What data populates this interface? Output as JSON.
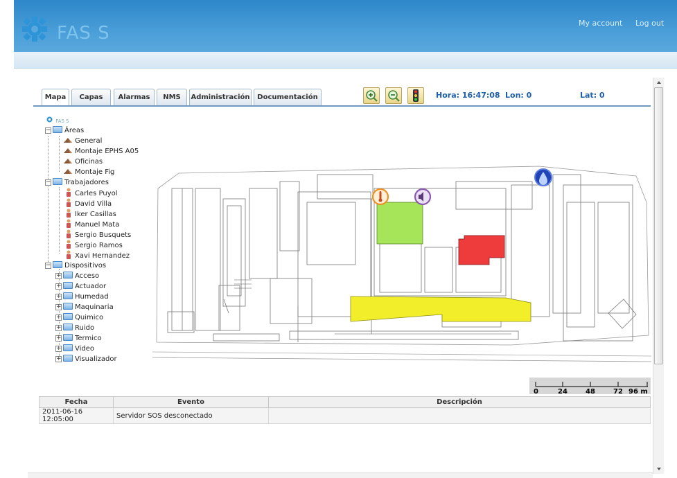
{
  "header": {
    "logo_text": "FAS S",
    "my_account": "My account",
    "log_out": "Log out"
  },
  "tabs": [
    {
      "label": "Mapa",
      "active": true
    },
    {
      "label": "Capas"
    },
    {
      "label": "Alarmas"
    },
    {
      "label": "NMS"
    },
    {
      "label": "Administración"
    },
    {
      "label": "Documentación"
    }
  ],
  "toolbar": {
    "zoom_in": "zoom-in-icon",
    "zoom_out": "zoom-out-icon",
    "traffic_light": "traffic-light-icon"
  },
  "status": {
    "hora": "Hora: 16:47:08",
    "lon": "Lon: 0",
    "lat": "Lat: 0"
  },
  "tree": {
    "root": "FAS S",
    "areas": {
      "label": "Áreas",
      "items": [
        "General",
        "Montaje EPHS A05",
        "Oficinas",
        "Montaje Fig"
      ]
    },
    "trabajadores": {
      "label": "Trabajadores",
      "items": [
        "Carles Puyol",
        "David Villa",
        "Iker Casillas",
        "Manuel Mata",
        "Sergio Busquets",
        "Sergio Ramos",
        "Xavi Hernandez"
      ]
    },
    "dispositivos": {
      "label": "Dispositivos",
      "items": [
        "Acceso",
        "Actuador",
        "Humedad",
        "Maquinaria",
        "Quimico",
        "Ruido",
        "Termico",
        "Video",
        "Visualizador"
      ]
    }
  },
  "map": {
    "zones": [
      {
        "name": "green-zone",
        "color": "#a6e45a"
      },
      {
        "name": "red-zone",
        "color": "#ee3b3b"
      },
      {
        "name": "yellow-zone",
        "color": "#f2ef2a"
      }
    ],
    "markers": [
      "thermometer-marker-icon",
      "noise-marker-icon",
      "humidity-marker-icon"
    ]
  },
  "scale": {
    "ticks": [
      "0",
      "24",
      "48",
      "72",
      "96 m"
    ]
  },
  "events": {
    "columns": [
      "Fecha",
      "Evento",
      "Descripción"
    ],
    "rows": [
      {
        "fecha": "2011-06-16 12:05:00",
        "evento": "Servidor SOS desconectado",
        "descripcion": ""
      }
    ]
  },
  "colors": {
    "header_blue": "#2d87c9",
    "accent_text": "#1d5fa8"
  }
}
